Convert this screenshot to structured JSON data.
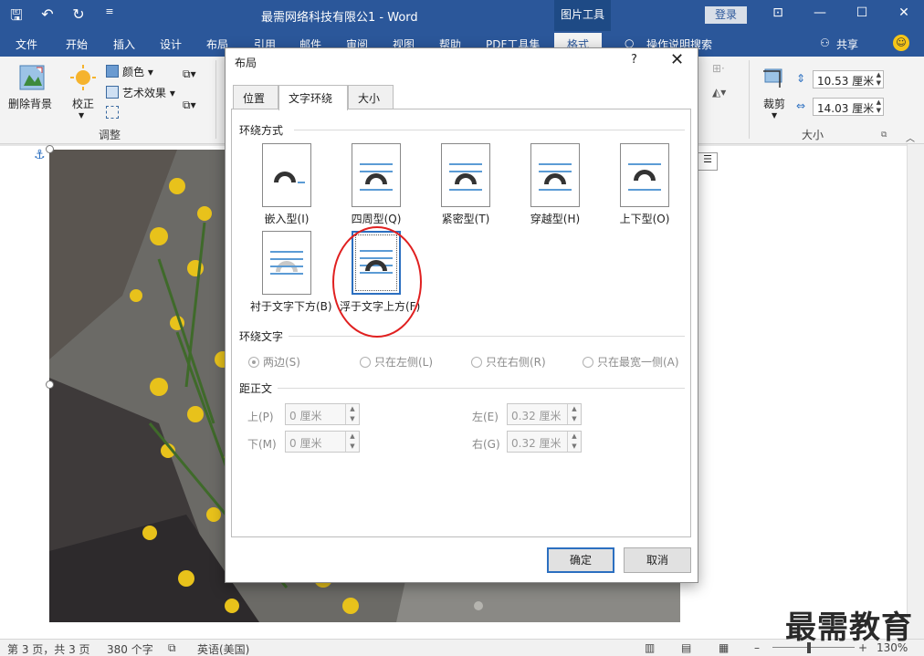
{
  "titlebar": {
    "doc_title": "最需网络科技有限公1  -  Word",
    "tools_tab": "图片工具",
    "login": "登录"
  },
  "tabs": [
    "文件",
    "开始",
    "插入",
    "设计",
    "布局",
    "引用",
    "邮件",
    "审阅",
    "视图",
    "帮助",
    "PDF工具集",
    "格式"
  ],
  "tabs_right": {
    "search": "操作说明搜索",
    "share": "共享"
  },
  "ribbon": {
    "remove_bg": "删除背景",
    "correct": "校正",
    "color": "颜色",
    "art_effects": "艺术效果",
    "adjust_group": "调整",
    "crop": "裁剪",
    "height": "10.53 厘米",
    "width": "14.03 厘米",
    "size_group": "大小"
  },
  "dialog": {
    "title": "布局",
    "help": "?",
    "tabs": [
      "位置",
      "文字环绕",
      "大小"
    ],
    "wrap_section": "环绕方式",
    "wrap_options": [
      "嵌入型(I)",
      "四周型(Q)",
      "紧密型(T)",
      "穿越型(H)",
      "上下型(O)",
      "衬于文字下方(B)",
      "浮于文字上方(F)"
    ],
    "wrap_text_section": "环绕文字",
    "wrap_text_options": [
      "两边(S)",
      "只在左侧(L)",
      "只在右侧(R)",
      "只在最宽一侧(A)"
    ],
    "distance_section": "距正文",
    "top_label": "上(P)",
    "top_value": "0 厘米",
    "bottom_label": "下(M)",
    "bottom_value": "0 厘米",
    "left_label": "左(E)",
    "left_value": "0.32 厘米",
    "right_label": "右(G)",
    "right_value": "0.32 厘米",
    "ok": "确定",
    "cancel": "取消"
  },
  "status": {
    "page": "第 3 页，共 3 页",
    "words": "380 个字",
    "lang": "英语(美国)",
    "zoom": "130%"
  },
  "watermark": "最需教育",
  "colors": {
    "accent": "#2b579a",
    "selected": "#2b6fc0",
    "annotation": "#e02020"
  }
}
